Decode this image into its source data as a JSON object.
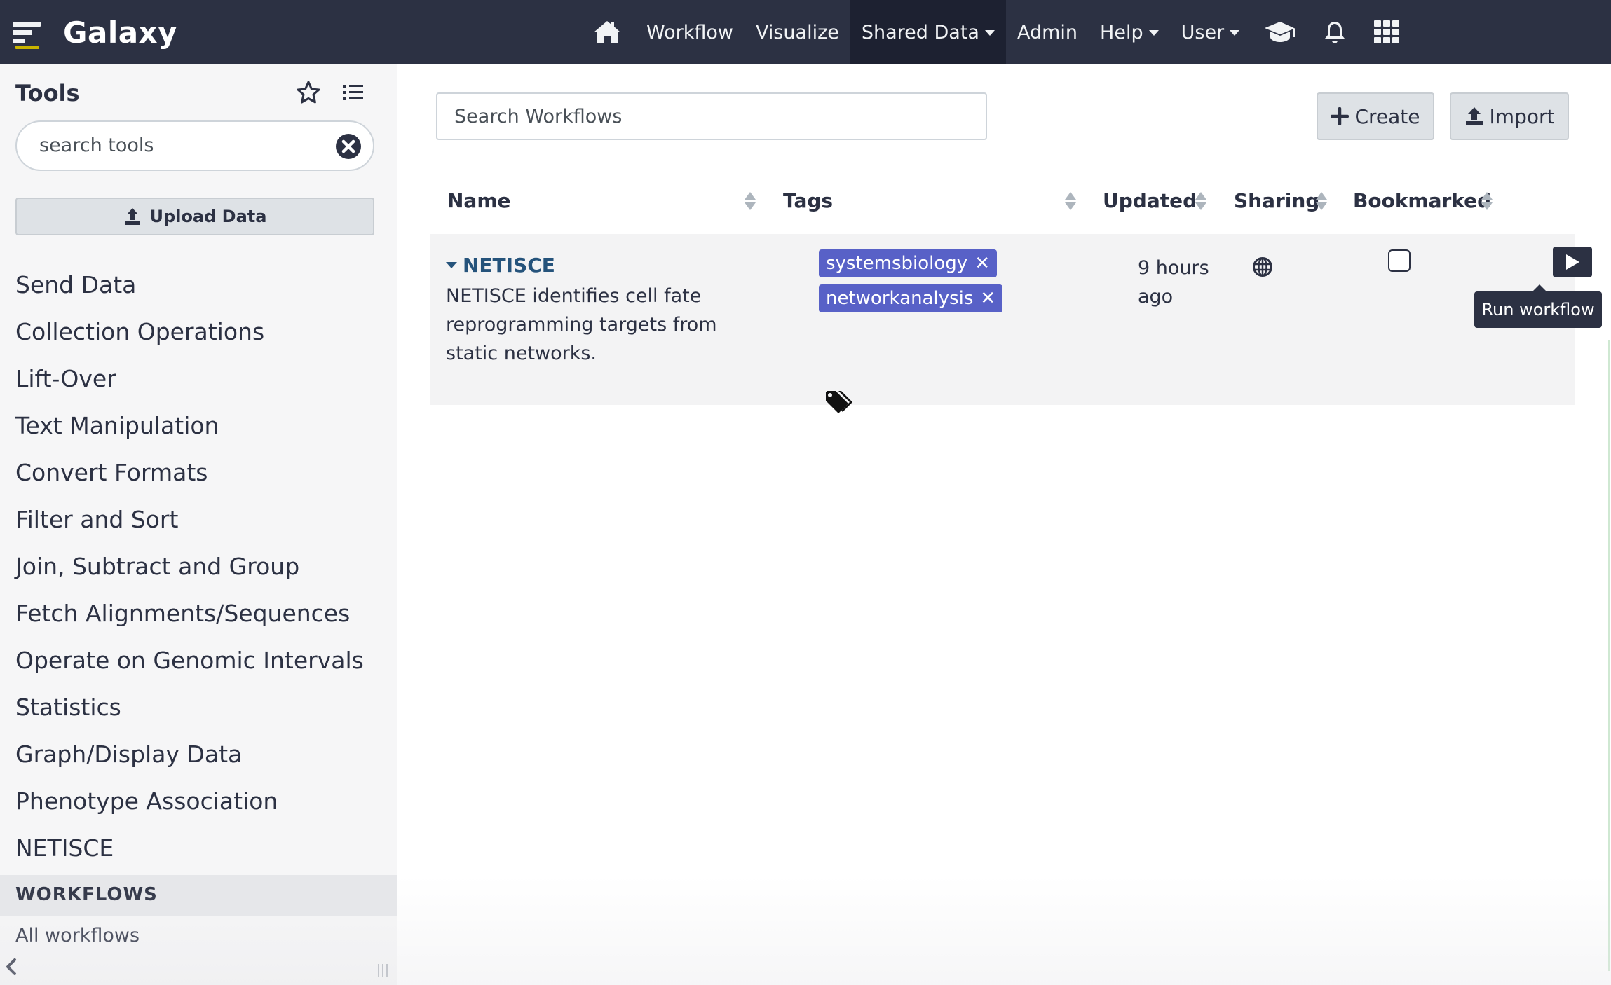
{
  "brand": {
    "title": "Galaxy"
  },
  "nav": {
    "workflow": "Workflow",
    "visualize": "Visualize",
    "shared_data": "Shared Data",
    "admin": "Admin",
    "help": "Help",
    "user": "User"
  },
  "tool_panel": {
    "title": "Tools",
    "search_placeholder": "search tools",
    "upload_label": "Upload Data",
    "sections": [
      "Send Data",
      "Collection Operations",
      "Lift-Over",
      "Text Manipulation",
      "Convert Formats",
      "Filter and Sort",
      "Join, Subtract and Group",
      "Fetch Alignments/Sequences",
      "Operate on Genomic Intervals",
      "Statistics",
      "Graph/Display Data",
      "Phenotype Association",
      "NETISCE"
    ],
    "workflows_header": "WORKFLOWS",
    "all_workflows": "All workflows"
  },
  "workflows": {
    "search_placeholder": "Search Workflows",
    "create_label": "Create",
    "import_label": "Import",
    "columns": {
      "name": "Name",
      "tags": "Tags",
      "updated": "Updated",
      "sharing": "Sharing",
      "bookmarked": "Bookmarked"
    },
    "rows": [
      {
        "name": "NETISCE",
        "description": "NETISCE identifies cell fate reprogramming targets from static networks.",
        "tags": [
          "systemsbiology",
          "networkanalysis"
        ],
        "updated": "9 hours ago",
        "bookmarked": false,
        "run_tooltip": "Run workflow"
      }
    ]
  },
  "colors": {
    "masthead": "#2c3143",
    "tag": "#5861c7",
    "link": "#25537b"
  }
}
